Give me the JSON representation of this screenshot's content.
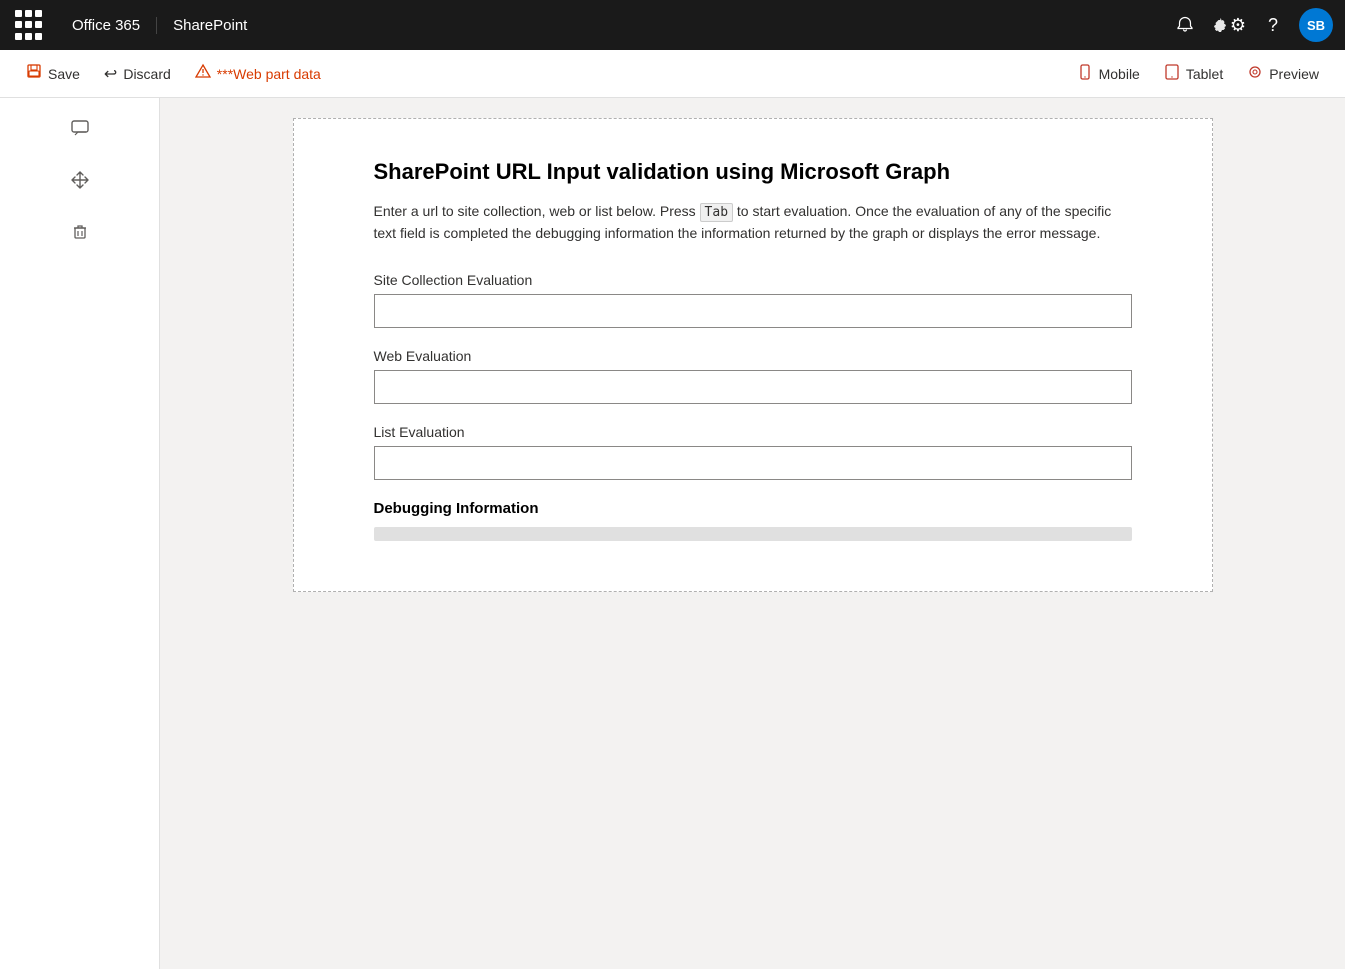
{
  "topnav": {
    "app_name": "Office 365",
    "app_sub": "SharePoint",
    "avatar_initials": "SB"
  },
  "toolbar": {
    "save_label": "Save",
    "discard_label": "Discard",
    "webpart_label": "***Web part data",
    "mobile_label": "Mobile",
    "tablet_label": "Tablet",
    "preview_label": "Preview"
  },
  "sidebar": {
    "icons": [
      "comment",
      "move",
      "delete"
    ]
  },
  "webpart": {
    "title": "SharePoint URL Input validation using Microsoft Graph",
    "description": "Enter a url to site collection, web or list below. Press Tab to start evaluation. Once the evaluation of any of the specific text field is completed the debugging information the information returned by the graph or displays the error message.",
    "tab_key": "Tab",
    "site_collection_label": "Site Collection Evaluation",
    "web_evaluation_label": "Web Evaluation",
    "list_evaluation_label": "List Evaluation",
    "debug_title": "Debugging Information"
  }
}
